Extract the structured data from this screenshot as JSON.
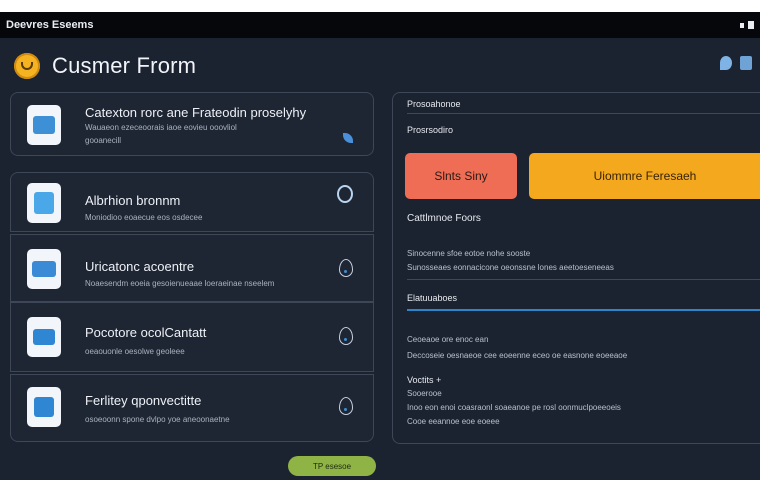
{
  "window": {
    "title": "Deevres Eseems"
  },
  "app": {
    "title": "Cusmer Frorm"
  },
  "cards": [
    {
      "title": "Catexton rorc ane Frateodin proselyhy",
      "desc_lines": [
        "Wauaeon ezeceoorais iaoe eovieu ooovliol",
        "gooanecill"
      ],
      "icon": "folder-icon"
    },
    {
      "title": "Albrhion bronnm",
      "desc_lines": [
        "Moniodioo eoaecue eos osdecee"
      ],
      "icon": "contact-card-icon"
    },
    {
      "title": "Uricatonc acoentre",
      "desc_lines": [
        "Noaesendm eoeia gesoienueaae loeraeinae nseelem"
      ],
      "icon": "id-card-icon"
    },
    {
      "title": "Pocotore ocolCantatt",
      "desc_lines": [
        "oeaouonle oesolwe geoleee"
      ],
      "icon": "chat-screen-icon"
    },
    {
      "title": "Ferlitey qponvectitte",
      "desc_lines": [
        "osoeoonn spone dvlpo yoe aneoonaetne"
      ],
      "icon": "window-grid-icon"
    }
  ],
  "panel": {
    "section1": "Prosoahonoe",
    "section1_sub": "Prosrsodiro",
    "btn_left": "Slnts Siny",
    "btn_right": "Uiommre Feresaeh",
    "section2": "Cattlmnoe Foors",
    "s2_lines": [
      "Sinocenne sfoe eotoe nohe sooste",
      "Sunosseaes eonnacicone oeonssne lones aeetoeseneeas"
    ],
    "section3": "Elatuuaboes",
    "s3_lines": [
      "Ceoeaoe ore enoc ean",
      "Deccoseie oesnaeoe cee eoeenne eceo oe easnone eoeeaoe"
    ],
    "section4": "Voctits +",
    "s4_lines": [
      "Sooerooe",
      "Inoo eon enoi coasraonl soaeanoe pe rosl oonmuclpoeeoeis",
      "Cooe eeannoe eoe eoeee"
    ]
  },
  "submit": {
    "label": "TP esesoe"
  },
  "colors": {
    "accent_blue": "#2d84c8",
    "salmon": "#ef6d55",
    "yellow": "#f4a81e",
    "green": "#8fb445",
    "logo": "#f6b321"
  }
}
